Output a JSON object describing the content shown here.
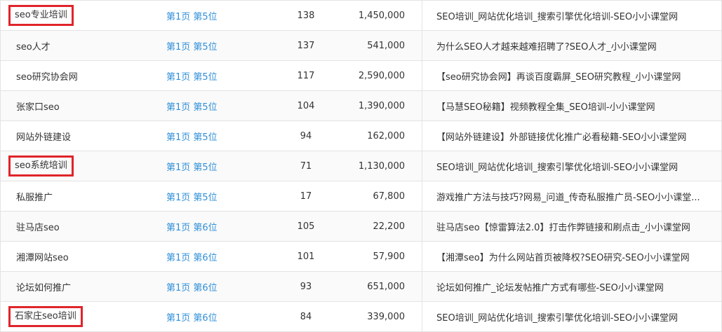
{
  "rows": [
    {
      "keyword": "seo专业培训",
      "rank": "第1页 第5位",
      "index": "138",
      "volume": "1,450,000",
      "title": "SEO培训_网站优化培训_搜索引擎优化培训-SEO小小课堂网",
      "highlight": true
    },
    {
      "keyword": "seo人才",
      "rank": "第1页 第5位",
      "index": "137",
      "volume": "541,000",
      "title": "为什么SEO人才越来越难招聘了?SEO人才_小小课堂网",
      "highlight": false
    },
    {
      "keyword": "seo研究协会网",
      "rank": "第1页 第5位",
      "index": "117",
      "volume": "2,590,000",
      "title": "【seo研究协会网】再谈百度霸屏_SEO研究教程_小小课堂网",
      "highlight": false
    },
    {
      "keyword": "张家口seo",
      "rank": "第1页 第5位",
      "index": "104",
      "volume": "1,390,000",
      "title": "【马慧SEO秘籍】视频教程全集_SEO培训-小小课堂网",
      "highlight": false
    },
    {
      "keyword": "网站外链建设",
      "rank": "第1页 第5位",
      "index": "94",
      "volume": "162,000",
      "title": "【网站外链建设】外部链接优化推广必看秘籍-SEO小小课堂网",
      "highlight": false
    },
    {
      "keyword": "seo系统培训",
      "rank": "第1页 第5位",
      "index": "71",
      "volume": "1,130,000",
      "title": "SEO培训_网站优化培训_搜索引擎优化培训-SEO小小课堂网",
      "highlight": true
    },
    {
      "keyword": "私服推广",
      "rank": "第1页 第5位",
      "index": "17",
      "volume": "67,800",
      "title": "游戏推广方法与技巧?网易_问道_传奇私服推广员-SEO小小课堂...",
      "highlight": false
    },
    {
      "keyword": "驻马店seo",
      "rank": "第1页 第6位",
      "index": "105",
      "volume": "22,200",
      "title": "驻马店seo【惊雷算法2.0】打击作弊链接和刷点击_小小课堂网",
      "highlight": false
    },
    {
      "keyword": "湘潭网站seo",
      "rank": "第1页 第6位",
      "index": "101",
      "volume": "57,900",
      "title": "【湘潭seo】为什么网站首页被降权?SEO研究-SEO小小课堂网",
      "highlight": false
    },
    {
      "keyword": "论坛如何推广",
      "rank": "第1页 第6位",
      "index": "93",
      "volume": "651,000",
      "title": "论坛如何推广_论坛发帖推广方式有哪些-SEO小小课堂网",
      "highlight": false
    },
    {
      "keyword": "石家庄seo培训",
      "rank": "第1页 第6位",
      "index": "84",
      "volume": "339,000",
      "title": "SEO培训_网站优化培训_搜索引擎优化培训-SEO小小课堂网",
      "highlight": true
    }
  ],
  "colors": {
    "rank_link": "#2f8fd8",
    "highlight_border": "#e0242a",
    "grid_line": "#e3e3e3"
  }
}
